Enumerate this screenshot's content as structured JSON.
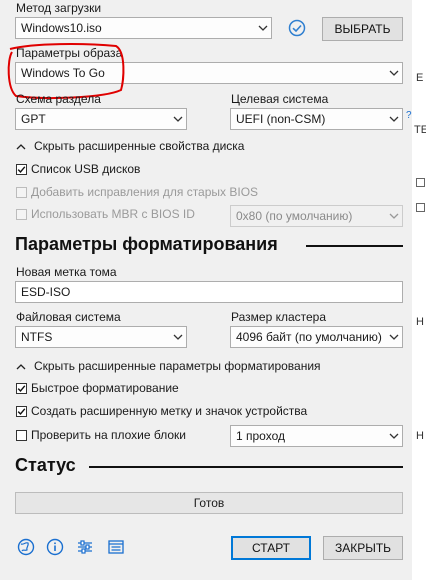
{
  "boot": {
    "label": "Метод загрузки",
    "value": "Windows10.iso",
    "select_button": "ВЫБРАТЬ"
  },
  "image_options": {
    "label": "Параметры образа",
    "value": "Windows To Go"
  },
  "partition_scheme": {
    "label": "Схема раздела",
    "value": "GPT"
  },
  "target_system": {
    "label": "Целевая система",
    "value": "UEFI (non-CSM)",
    "help": "?"
  },
  "drive_props_toggle": "Скрыть расширенные свойства диска",
  "checkboxes": {
    "usb_list": "Список USB дисков",
    "old_bios": "Добавить исправления для старых BIOS",
    "mbr_bios": "Использовать MBR с BIOS ID"
  },
  "bios_id": {
    "value": "0x80 (по умолчанию)"
  },
  "format_section": {
    "title": "Параметры форматирования"
  },
  "volume_label": {
    "label": "Новая метка тома",
    "value": "ESD-ISO"
  },
  "filesystem": {
    "label": "Файловая система",
    "value": "NTFS"
  },
  "cluster_size": {
    "label": "Размер кластера",
    "value": "4096 байт (по умолчанию)"
  },
  "format_toggle": "Скрыть расширенные параметры форматирования",
  "format_checkboxes": {
    "quick": "Быстрое форматирование",
    "extended_label": "Создать расширенную метку и значок устройства",
    "bad_blocks": "Проверить на плохие блоки"
  },
  "passes": {
    "value": "1 проход"
  },
  "status_section": {
    "title": "Статус",
    "progress_text": "Готов"
  },
  "footer": {
    "start": "СТАРТ",
    "close": "ЗАКРЫТЬ"
  },
  "edge_fragments": [
    "Е",
    "ТЕ",
    "Н",
    "Н"
  ],
  "colors": {
    "annotation": "#e00000",
    "accent": "#0078d7"
  }
}
